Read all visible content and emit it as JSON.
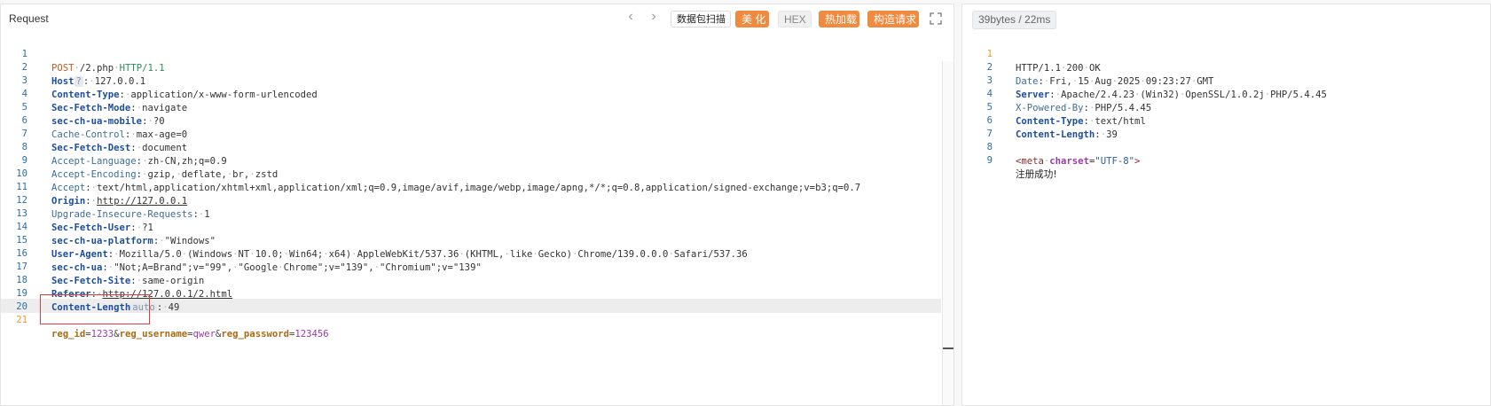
{
  "request": {
    "title": "Request",
    "buttons": {
      "scan": "数据包扫描",
      "beautify": "美 化",
      "hex": "HEX",
      "hotload": "热加载",
      "build": "构造请求"
    },
    "method": "POST",
    "path": "/2.php",
    "protocol": "HTTP/1.1",
    "host_badge": "?",
    "host_value": "127.0.0.1",
    "length_badge": "auto",
    "headers": [
      {
        "name": "Host",
        "value": "127.0.0.1"
      },
      {
        "name": "Content-Type",
        "value": "application/x-www-form-urlencoded"
      },
      {
        "name": "Sec-Fetch-Mode",
        "value": "navigate"
      },
      {
        "name": "sec-ch-ua-mobile",
        "value": "?0"
      },
      {
        "name": "Cache-Control",
        "value": "max-age=0"
      },
      {
        "name": "Sec-Fetch-Dest",
        "value": "document"
      },
      {
        "name": "Accept-Language",
        "value": "zh-CN,zh;q=0.9"
      },
      {
        "name": "Accept-Encoding",
        "value": "gzip, deflate, br, zstd"
      },
      {
        "name": "Accept",
        "value": "text/html,application/xhtml+xml,application/xml;q=0.9,image/avif,image/webp,image/apng,*/*;q=0.8,application/signed-exchange;v=b3;q=0.7"
      },
      {
        "name": "Origin",
        "value": "http://127.0.0.1"
      },
      {
        "name": "Upgrade-Insecure-Requests",
        "value": "1"
      },
      {
        "name": "Sec-Fetch-User",
        "value": "?1"
      },
      {
        "name": "sec-ch-ua-platform",
        "value": "\"Windows\""
      },
      {
        "name": "User-Agent",
        "value": "Mozilla/5.0 (Windows NT 10.0; Win64; x64) AppleWebKit/537.36 (KHTML, like Gecko) Chrome/139.0.0.0 Safari/537.36"
      },
      {
        "name": "sec-ch-ua",
        "value": "\"Not;A=Brand\";v=\"99\", \"Google Chrome\";v=\"139\", \"Chromium\";v=\"139\""
      },
      {
        "name": "Sec-Fetch-Site",
        "value": "same-origin"
      },
      {
        "name": "Referer",
        "value": "http://127.0.0.1/2.html"
      },
      {
        "name": "Content-Length",
        "value": "49"
      }
    ],
    "body_params": [
      {
        "key": "reg_id",
        "value": "1233"
      },
      {
        "key": "reg_username",
        "value": "qwer"
      },
      {
        "key": "reg_password",
        "value": "123456"
      }
    ]
  },
  "response": {
    "stats": "39bytes / 22ms",
    "status_line": "HTTP/1.1 200 OK",
    "headers": [
      {
        "name": "Date",
        "value": "Fri, 15 Aug 2025 09:23:27 GMT"
      },
      {
        "name": "Server",
        "value": "Apache/2.4.23 (Win32) OpenSSL/1.0.2j PHP/5.4.45"
      },
      {
        "name": "X-Powered-By",
        "value": "PHP/5.4.45"
      },
      {
        "name": "Content-Type",
        "value": "text/html"
      },
      {
        "name": "Content-Length",
        "value": "39"
      }
    ],
    "meta_tag": "meta",
    "meta_attr": "charset",
    "meta_value": "\"UTF-8\"",
    "body_text": "注册成功!"
  },
  "icons": {
    "back": "chevron-left-icon",
    "forward": "chevron-right-icon",
    "fullscreen": "expand-icon"
  },
  "colors": {
    "accent_orange": "#f08a3e",
    "line_number_blue": "#2b6ea9",
    "highlight_red": "#e23b3b"
  }
}
